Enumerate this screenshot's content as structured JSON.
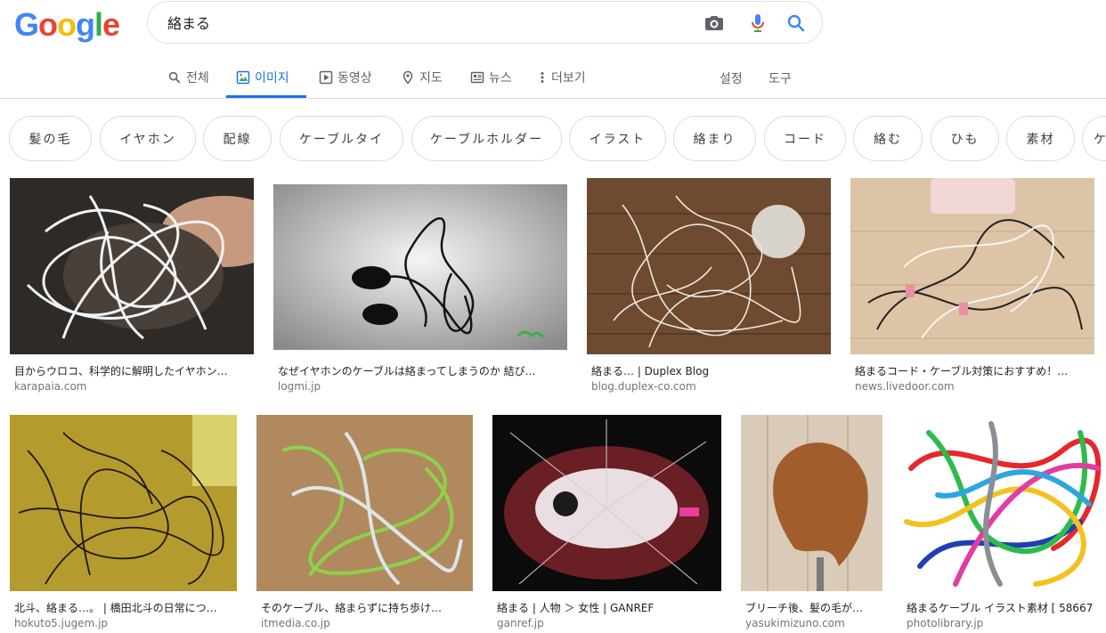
{
  "logo": {
    "letters": [
      "G",
      "o",
      "o",
      "g",
      "l",
      "e"
    ],
    "colors": [
      "#4285f4",
      "#ea4335",
      "#fbbc05",
      "#4285f4",
      "#34a853",
      "#ea4335"
    ]
  },
  "search": {
    "query": "絡まる",
    "camera_icon": "camera-icon",
    "mic_icon": "mic-icon",
    "search_icon": "search-icon"
  },
  "tabs": [
    {
      "label": "전체",
      "icon": "search-icon"
    },
    {
      "label": "이미지",
      "icon": "image-icon",
      "active": true
    },
    {
      "label": "동영상",
      "icon": "video-icon"
    },
    {
      "label": "지도",
      "icon": "map-pin-icon"
    },
    {
      "label": "뉴스",
      "icon": "news-icon"
    },
    {
      "label": "더보기",
      "icon": "more-vert-icon"
    }
  ],
  "tools": {
    "settings": "설정",
    "tools": "도구"
  },
  "accent_color": "#1a73e8",
  "chips": [
    "髪の毛",
    "イヤホン",
    "配線",
    "ケーブルタイ",
    "ケーブルホルダー",
    "イラスト",
    "絡まり",
    "コード",
    "絡む",
    "ひも",
    "素材",
    "ケ"
  ],
  "results": [
    {
      "title": "目からウロコ、科学的に解明したイヤホン…",
      "site": "karapaia.com"
    },
    {
      "title": "なぜイヤホンのケーブルは絡まってしまうのか 結び…",
      "site": "logmi.jp"
    },
    {
      "title": "絡まる… | Duplex Blog",
      "site": "blog.duplex-co.com"
    },
    {
      "title": "絡まるコード・ケーブル対策におすすめ！…",
      "site": "news.livedoor.com"
    },
    {
      "title": "北斗、絡まる…。 | 橋田北斗の日常につ…",
      "site": "hokuto5.jugem.jp"
    },
    {
      "title": "そのケーブル、絡まらずに持ち歩け…",
      "site": "itmedia.co.jp"
    },
    {
      "title": "絡まる | 人物 ＞ 女性 | GANREF",
      "site": "ganref.jp"
    },
    {
      "title": "ブリーチ後、髪の毛が…",
      "site": "yasukimizuno.com"
    },
    {
      "title": "絡まるケーブル イラスト素材 [ 58667",
      "site": "photolibrary.jp"
    }
  ]
}
